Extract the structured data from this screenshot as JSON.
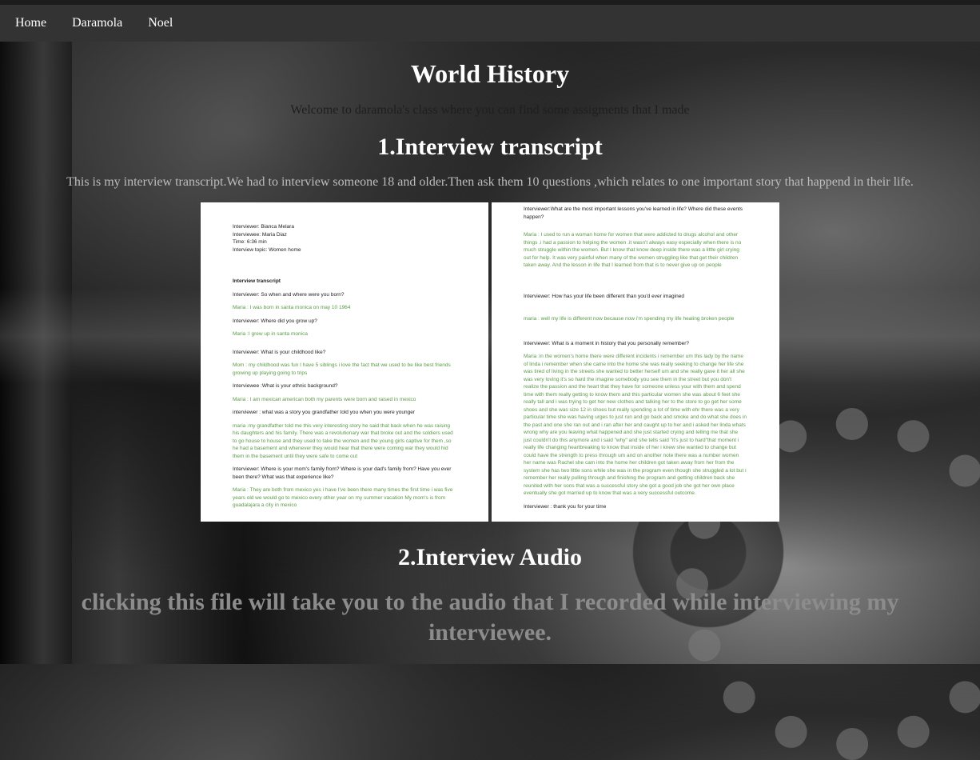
{
  "nav": {
    "items": [
      "Home",
      "Daramola",
      "Noel"
    ]
  },
  "page": {
    "title": "World History",
    "welcome": "Welcome to daramola's class where you can find some assigments that I made"
  },
  "section1": {
    "heading": "1.Interview transcript",
    "description": "This is my interview transcript.We had to interview someone 18 and older.Then ask them 10 questions ,which relates to one important story that happend in their life."
  },
  "transcript_left": {
    "interviewer": "Interviewer: Bianca Melara",
    "interviewee": "Interviewee: Maria Diaz",
    "time": "Time: 6:36 min",
    "topic": "Interview topic: Women home",
    "heading": "Interview transcript",
    "q1": "Interviewer: So when and where were you born?",
    "a1": "Maria  : I was born in santa monica on may 10 1964",
    "q2": "Interviewer: Where did you grow up?",
    "a2": "Maria  :I grew up in santa monica",
    "q3": "Interviewer: What is your childhood like?",
    "a3": "Mom : my childhood was fun I have 5 siblings i love the fact that we used to be like best friends growing up playing going to trips",
    "q4": "Interviewee :What is your ethnic background?",
    "a4": "Maria  : I am mexican american both my parents were born and raised in mexico",
    "q5": "interviewer : what was a story you grandfather told you when you were younger",
    "a5": "maria :my grandfather told me this very interesting story he said that back when he was raising his daughters and his family. There was a revolutionary war that broke out and the soldiers used to go house to house and they used to take the women and the young girls captive for them ,so he had a basement and whenever they would hear that there were coming war they would hid them in the basement until they were safe to come out",
    "q6": "Interviewer: Where is your mom's family from? Where is your dad's family from?  Have you ever been there? What was that experience like?",
    "a6": "Maria  : They are both from mexico yes i have I've been there many times the first time i was five years old we would go to mexico every other year on my summer vacation My mom's is from guadalajara a city in mexico"
  },
  "transcript_right": {
    "q7": "Interviewer:What are the most important lessons you've learned in life?  Where did these events happen?",
    "a7": "Maria  : I used to run a woman home for women that were addicted to drugs alcohol and other things .i had a passion to helping the women .it wasn't always easy especially when there is no much struggle within the women. But I know that know deep inside there was a little girl crying out for help. It was very painful when many of the women struggling like that get their children taken away. And the lesson in life that I learned from that is to never give up on people",
    "q8": "Interviewer: How has your life been different than you'd ever imagined",
    "a8": "maria : well my life is different now because now i'm spending my life healing broken people",
    "q9": "Interviewer: What is a moment in history that you personally remember?",
    "a9": "Maria :in the women's home there were different incidents i remember um this lady by the name of linda i remember when she came into the home she was really seeking to change her life she was tired of living in the streets she wanted to better herself um and she really gave it her all she was very loving  it's so hard the imagine somebody you see them in the street but you don't realize the passion and the heart that they have for someone unless your with them and spend time with them really getting to know them and this particular women she was about 6 feet she really tall and i was trying to get her new clothes and talking her to the store to go get her some shoes and she was size 12 in shoes but really spending a lot of time with ehr there was a very particular time she was having urges to just run and go back and smoke and do what she does in the past and one she ran out and i ran after her and caught up to her and i asked her linda whats wrong why are you leaving what happened and she just started crying and telling me that she just couldn't do this anymore and i said \"why\" and she tells said \"it's just to hard\"that moment i really life changing heartbreaking to know that inside of her i knew she wanted to change but could have the strength to press through um and on another note there was a number women her name was Rachel she cam into the home  her children got taken away from her from the system she has two little sons while she was in the program even though she struggled a lot but i remember her really pulling through and finishing the program and getting children back she reunited with her sons that was a successful story she got a good job she got her own place eventually she got married up to know that was a very successful outcome.",
    "q10": "Interviewer : thank you for your time"
  },
  "section2": {
    "heading": "2.Interview Audio",
    "link_text": "clicking this file will take you to the audio that I recorded while interviewing my interviewee."
  }
}
